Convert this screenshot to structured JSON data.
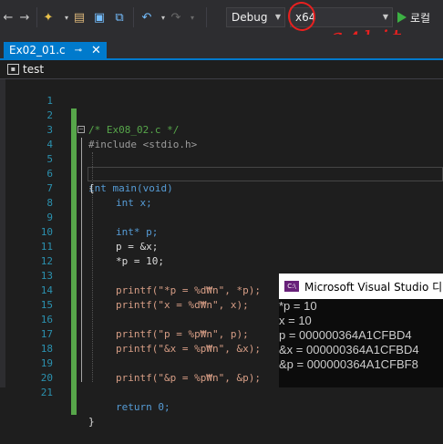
{
  "toolbar": {
    "config_value": "Debug",
    "platform_value": "x64",
    "run_label": "로컬"
  },
  "annotation": {
    "text": "64bit"
  },
  "tab": {
    "title": "Ex02_01.c",
    "pin_glyph": "⊸",
    "close_glyph": "✕"
  },
  "navbar": {
    "project": "test"
  },
  "code": {
    "lines": [
      {
        "n": "1",
        "t": "/* Ex08_02.c */"
      },
      {
        "n": "2",
        "t": "#include <stdio.h>"
      },
      {
        "n": "3",
        "t": ""
      },
      {
        "n": "4",
        "t": "int main(void)"
      },
      {
        "n": "5",
        "t": "{"
      },
      {
        "n": "6",
        "t": "int x;"
      },
      {
        "n": "7",
        "t": "int* p;"
      },
      {
        "n": "8",
        "t": ""
      },
      {
        "n": "9",
        "t": "p = &x;"
      },
      {
        "n": "10",
        "t": "*p = 10;"
      },
      {
        "n": "11",
        "t": ""
      },
      {
        "n": "12",
        "t": "printf(\"*p = %d₩n\", *p);"
      },
      {
        "n": "13",
        "t": "printf(\"x = %d₩n\", x);"
      },
      {
        "n": "14",
        "t": ""
      },
      {
        "n": "15",
        "t": "printf(\"p = %p₩n\", p);"
      },
      {
        "n": "16",
        "t": "printf(\"&x = %p₩n\", &x);"
      },
      {
        "n": "17",
        "t": ""
      },
      {
        "n": "18",
        "t": "printf(\"&p = %p₩n\", &p);"
      },
      {
        "n": "19",
        "t": ""
      },
      {
        "n": "20",
        "t": "return 0;"
      },
      {
        "n": "21",
        "t": "}"
      }
    ]
  },
  "console": {
    "title": "Microsoft Visual Studio 디버",
    "icon_label": "C:\\",
    "output": [
      "*p = 10",
      "x = 10",
      "p = 000000364A1CFBD4",
      "&x = 000000364A1CFBD4",
      "&p = 000000364A1CFBF8"
    ]
  },
  "colors": {
    "accent": "#007acc",
    "annotation": "#e8201f",
    "run": "#3cb043",
    "line_numbers": "#2b91af",
    "change_bar": "#57a64a"
  }
}
